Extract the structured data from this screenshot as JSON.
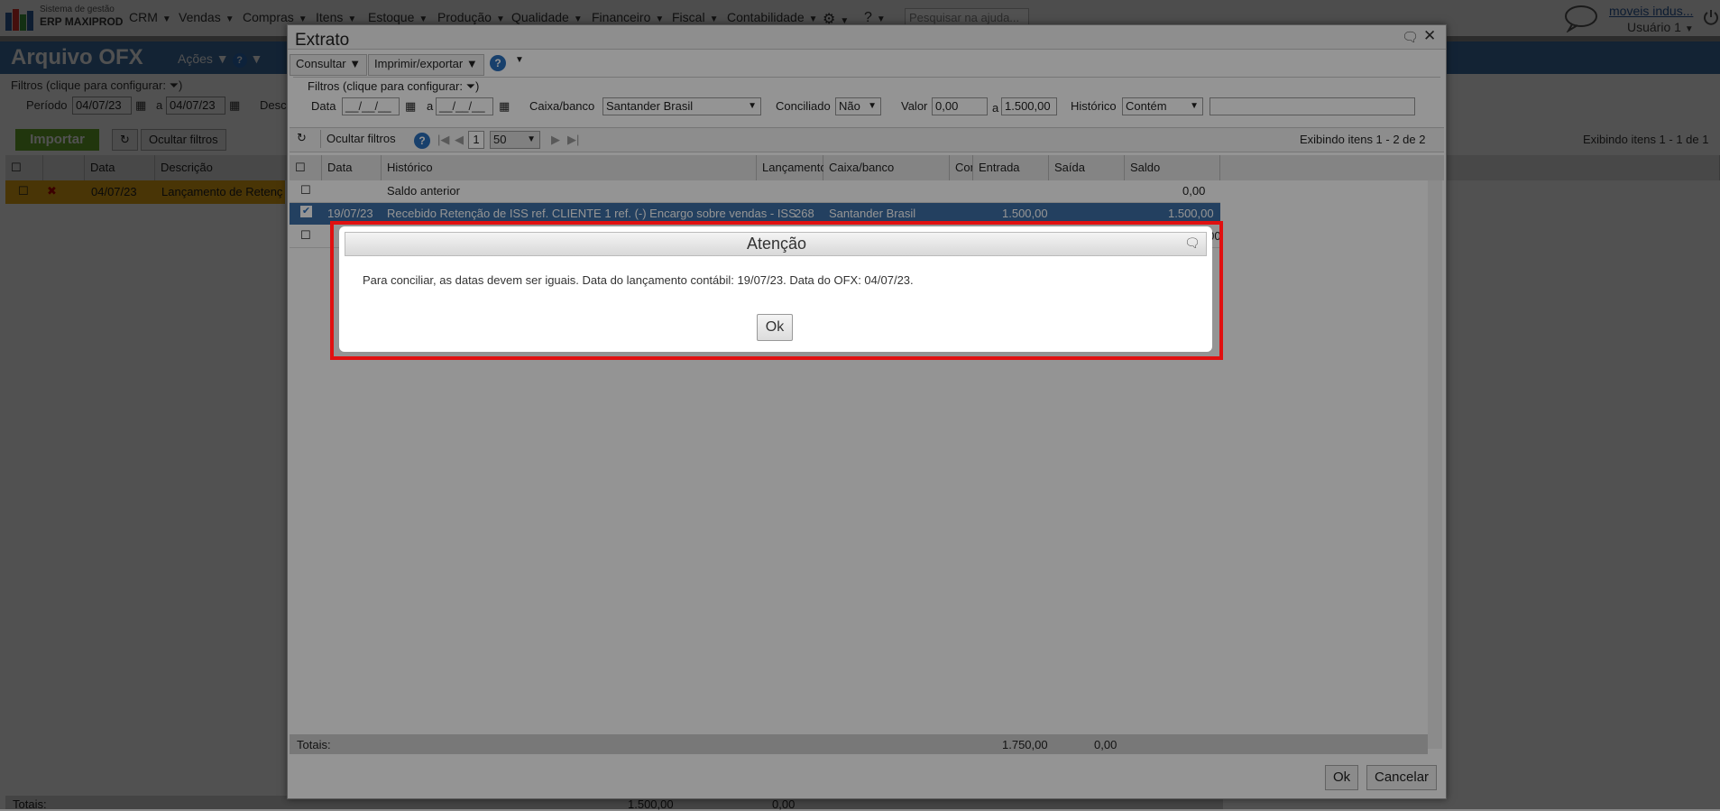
{
  "topnav": {
    "logo_line1": "Sistema de gestão",
    "logo_line2": "ERP MAXIPROD",
    "menu": [
      "CRM",
      "Vendas",
      "Compras",
      "Itens",
      "Estoque",
      "Produção",
      "Qualidade",
      "Financeiro",
      "Fiscal",
      "Contabilidade"
    ],
    "search_placeholder": "Pesquisar na ajuda...",
    "company": "moveis indus...",
    "user": "Usuário 1"
  },
  "background_page": {
    "title": "Arquivo OFX",
    "actions_label": "Ações",
    "filters_legend": "Filtros (clique para configurar:",
    "periodo_label": "Período",
    "periodo_from": "04/07/23",
    "periodo_to_label": "a",
    "periodo_to": "04/07/23",
    "desc_label": "Desc",
    "import_button": "Importar",
    "hide_filters": "Ocultar filtros",
    "display_info": "Exibindo itens 1 - 1 de 1",
    "columns": [
      "Data",
      "Descrição"
    ],
    "row": {
      "date": "04/07/23",
      "description": "Lançamento de Retenç"
    },
    "totals_label": "Totais:",
    "totals_values": [
      "1.500,00",
      "0,00"
    ]
  },
  "extrato": {
    "title": "Extrato",
    "toolbar": {
      "consultar": "Consultar",
      "imprimir": "Imprimir/exportar"
    },
    "filters": {
      "legend": "Filtros (clique para configurar:",
      "data_label": "Data",
      "date_placeholder": "__/__/__",
      "a_label": "a",
      "caixa_label": "Caixa/banco",
      "caixa_value": "Santander Brasil",
      "conciliado_label": "Conciliado",
      "conciliado_value": "Não",
      "valor_label": "Valor",
      "valor_from": "0,00",
      "valor_to": "1.500,00",
      "historico_label": "Histórico",
      "historico_mode": "Contém"
    },
    "pager": {
      "hide_filters": "Ocultar filtros",
      "page": "1",
      "per_page": "50",
      "display_info": "Exibindo itens 1 - 2 de 2"
    },
    "columns": [
      "Data",
      "Histórico",
      "Lançamento",
      "Caixa/banco",
      "Con",
      "Entrada",
      "Saída",
      "Saldo"
    ],
    "rows": [
      {
        "date": "",
        "history": "Saldo anterior",
        "launch": "",
        "bank": "",
        "entrada": "",
        "saida": "",
        "saldo": "0,00",
        "selected": false
      },
      {
        "date": "19/07/23",
        "history": "Recebido Retenção de ISS ref. CLIENTE 1 ref. (-) Encargo sobre vendas - ISS",
        "launch": "268",
        "bank": "Santander Brasil",
        "entrada": "1.500,00",
        "saida": "",
        "saldo": "1.500,00",
        "selected": true
      },
      {
        "date": "",
        "history": "",
        "launch": "",
        "bank": "",
        "entrada": "",
        "saida": "",
        "saldo": "1.750,00",
        "selected": false
      }
    ],
    "totals": {
      "label": "Totais:",
      "entrada": "1.750,00",
      "saida": "0,00"
    },
    "ok_button": "Ok",
    "cancel_button": "Cancelar"
  },
  "alert": {
    "title": "Atenção",
    "message": "Para conciliar, as datas devem ser iguais. Data do lançamento contábil: 19/07/23. Data do OFX: 04/07/23.",
    "ok_button": "Ok"
  }
}
